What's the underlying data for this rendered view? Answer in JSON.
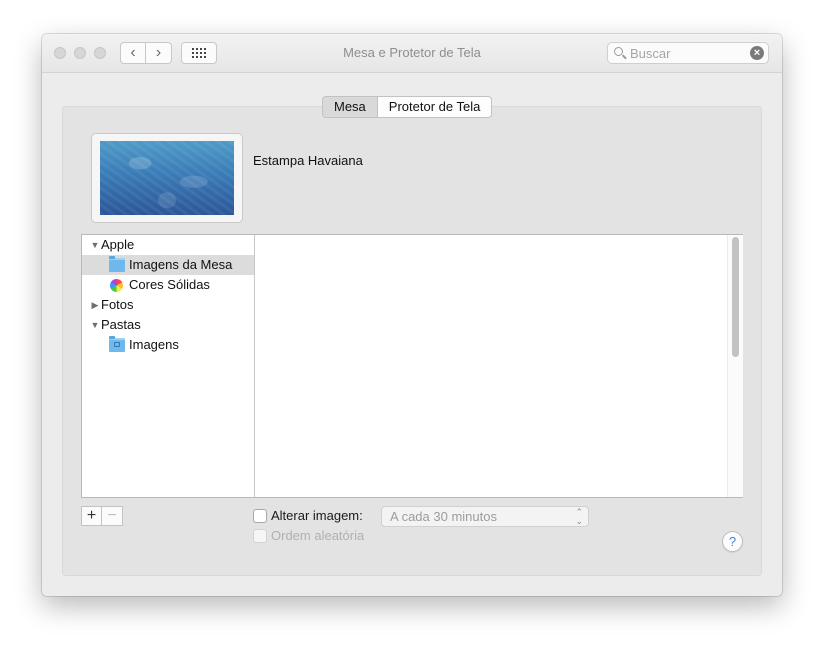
{
  "window": {
    "title": "Mesa e Protetor de Tela"
  },
  "search": {
    "placeholder": "Buscar",
    "value": ""
  },
  "tabs": [
    {
      "label": "Mesa",
      "selected": true
    },
    {
      "label": "Protetor de Tela",
      "selected": false
    }
  ],
  "wallpaper": {
    "name": "Estampa Havaiana"
  },
  "sources": [
    {
      "label": "Apple",
      "type": "group",
      "expanded": true
    },
    {
      "label": "Imagens da Mesa",
      "type": "folder",
      "selected": true
    },
    {
      "label": "Cores Sólidas",
      "type": "colors"
    },
    {
      "label": "Fotos",
      "type": "group",
      "expanded": false
    },
    {
      "label": "Pastas",
      "type": "group",
      "expanded": true
    },
    {
      "label": "Imagens",
      "type": "folder"
    }
  ],
  "options": {
    "change_picture_label": "Alterar imagem:",
    "change_picture_checked": false,
    "interval": "A cada 30 minutos",
    "random_order_label": "Ordem aleatória",
    "random_order_checked": false
  },
  "buttons": {
    "add": "+",
    "remove": "−",
    "help": "?",
    "back": "‹",
    "forward": "›",
    "clear_search": "×"
  },
  "icons": {
    "disclosure_expanded": "▼",
    "disclosure_collapsed": "▶",
    "select_arrows_up": "⌃",
    "select_arrows_down": "⌄"
  }
}
